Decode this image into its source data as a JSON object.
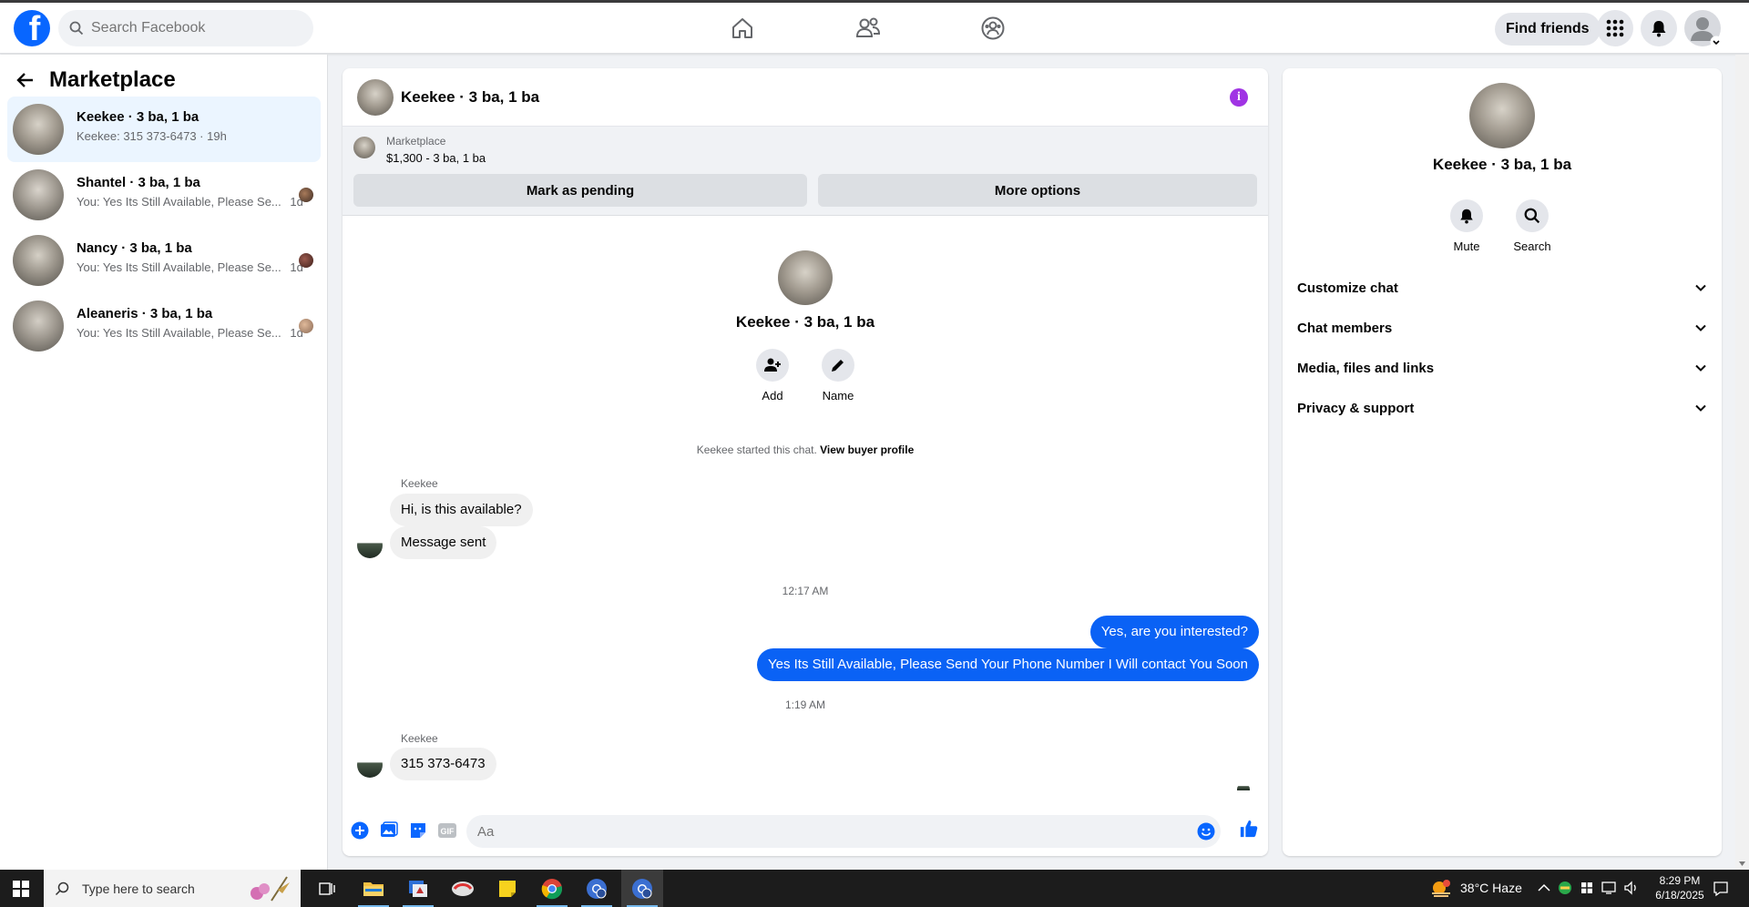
{
  "topnav": {
    "search_placeholder": "Search Facebook",
    "find_friends": "Find friends"
  },
  "left": {
    "title": "Marketplace",
    "conversations": [
      {
        "name": "Keekee · 3 ba, 1 ba",
        "snippet": "Keekee: 315 373-6473 · 19h",
        "time": "",
        "active": true
      },
      {
        "name": "Shantel · 3 ba, 1 ba",
        "snippet": "You: Yes Its Still Available, Please Se...",
        "time": "1d"
      },
      {
        "name": "Nancy · 3 ba, 1 ba",
        "snippet": "You: Yes Its Still Available, Please Se...",
        "time": "1d"
      },
      {
        "name": "Aleaneris · 3 ba, 1 ba",
        "snippet": "You: Yes Its Still Available, Please Se...",
        "time": "1d"
      }
    ]
  },
  "chat": {
    "title": "Keekee · 3 ba, 1 ba",
    "marketplace_label": "Marketplace",
    "listing": "$1,300 - 3 ba, 1 ba",
    "mark_pending": "Mark as pending",
    "more_options": "More options",
    "profile_name": "Keekee · 3 ba, 1 ba",
    "add_label": "Add",
    "name_label": "Name",
    "started_text": "Keekee started this chat.",
    "view_buyer": "View buyer profile",
    "sender1": "Keekee",
    "msg1": "Hi, is this available?",
    "msg2": "Message sent",
    "time1": "12:17 AM",
    "out1": "Yes, are you interested?",
    "out2": "Yes Its Still Available, Please Send Your Phone Number I Will contact You Soon",
    "time2": "1:19 AM",
    "sender2": "Keekee",
    "msg3": "315 373-6473",
    "composer_placeholder": "Aa"
  },
  "right": {
    "name": "Keekee · 3 ba, 1 ba",
    "mute": "Mute",
    "search": "Search",
    "items": [
      "Customize chat",
      "Chat members",
      "Media, files and links",
      "Privacy & support"
    ]
  },
  "taskbar": {
    "search_placeholder": "Type here to search",
    "weather": "38°C  Haze",
    "time": "8:29 PM",
    "date": "6/18/2025"
  },
  "colors": {
    "fb_blue": "#0866ff",
    "outgoing_bubble": "#0a62f5",
    "info_purple": "#a033e4"
  }
}
